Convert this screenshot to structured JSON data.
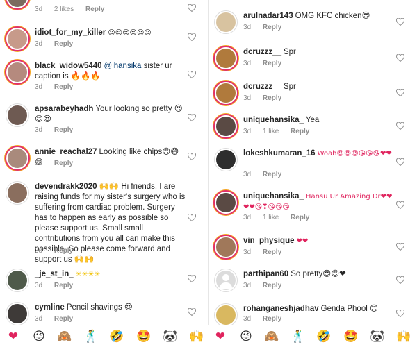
{
  "left_panel": {
    "comments": [
      {
        "user": "",
        "text": "",
        "time": "3d",
        "likes": "2 likes",
        "reply": "Reply"
      },
      {
        "user": "idiot_for_my_killer",
        "text": "😍😍😍😍😍😍",
        "time": "3d",
        "likes": "",
        "reply": "Reply"
      },
      {
        "user": "black_widow5440",
        "mention": "@ihansika",
        "text": " sister ur caption is 🔥🔥🔥",
        "time": "3d",
        "likes": "",
        "reply": "Reply"
      },
      {
        "user": "apsarabeyhadh",
        "text": "Your looking so pretty 😍😍😍",
        "time": "3d",
        "likes": "",
        "reply": "Reply"
      },
      {
        "user": "annie_reachal27",
        "text": "Looking like chips😍😄😄",
        "time": "3d",
        "likes": "",
        "reply": "Reply"
      },
      {
        "user": "devendrakk2020",
        "text": "🙌🙌 Hi friends, I are raising funds for my sister's surgery who is suffering from cardiac problem. Surgery has to happen as early as possible so please support us. Small small contributions from you all can make this possible. So please come forward and support us 🙌🙌",
        "time": "3d",
        "likes": "",
        "reply": "Reply"
      },
      {
        "user": "_je_st_in_",
        "text": "☀☀☀☀",
        "time": "3d",
        "likes": "",
        "reply": "Reply"
      },
      {
        "user": "cymline",
        "text": "Pencil shavings 😍",
        "time": "3d",
        "likes": "",
        "reply": "Reply"
      }
    ]
  },
  "right_panel": {
    "comments": [
      {
        "user": "arulnadar143",
        "text": "OMG KFC chicken😍",
        "time": "3d",
        "likes": "",
        "reply": "Reply"
      },
      {
        "user": "dcruzzz__",
        "text": "Spr",
        "time": "3d",
        "likes": "",
        "reply": "Reply"
      },
      {
        "user": "dcruzzz__",
        "text": "Spr",
        "time": "3d",
        "likes": "",
        "reply": "Reply"
      },
      {
        "user": "uniquehansika_",
        "text": "Yea",
        "time": "3d",
        "likes": "1 like",
        "reply": "Reply"
      },
      {
        "user": "lokeshkumaran_16",
        "text": "Woah😍😍😍😘😘😘❤❤",
        "time": "3d",
        "likes": "",
        "reply": "Reply"
      },
      {
        "user": "uniquehansika_",
        "text": "Hansu Ur Amazing Dr❤❤❤❤😘❣😘😘😘",
        "time": "3d",
        "likes": "1 like",
        "reply": "Reply"
      },
      {
        "user": "vin_physique",
        "text": "❤❤",
        "time": "3d",
        "likes": "",
        "reply": "Reply"
      },
      {
        "user": "parthipan60",
        "text": "So pretty😍😍❤",
        "time": "3d",
        "likes": "",
        "reply": "Reply"
      },
      {
        "user": "rohanganeshjadhav",
        "text": "Genda Phool 😍",
        "time": "3d",
        "likes": "",
        "reply": "Reply"
      }
    ]
  },
  "emoji_bar": {
    "left": [
      "❤",
      "😜",
      "🙈",
      "🕺",
      "🤣",
      "🤩",
      "🐼",
      "🙌"
    ],
    "right": [
      "❤",
      "😜",
      "🙈",
      "🕺",
      "🤣",
      "🤩",
      "🐼",
      "🙌"
    ]
  },
  "colors": {
    "story_ring": "#e1306c",
    "meta_text": "#8e8e8e",
    "mention": "#00376b",
    "heart_outline": "#8e8e8e"
  }
}
